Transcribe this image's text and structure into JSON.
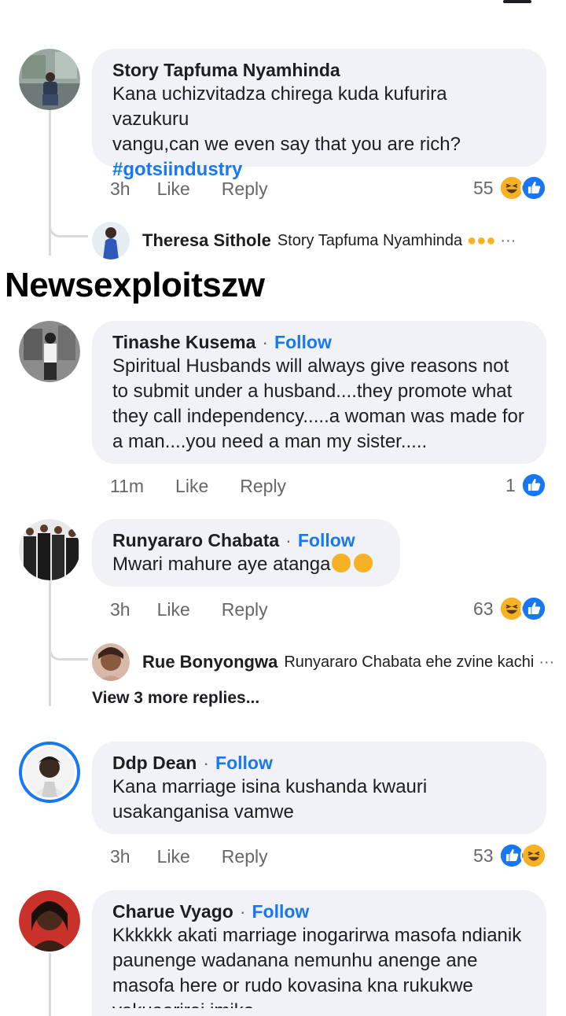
{
  "comments": [
    {
      "author": "Story Tapfuma Nyamhinda",
      "lines": [
        "Kana uchizvitadza chirega kuda kufurira vazukuru",
        "vangu,can we even say that you are rich?"
      ],
      "hashtag": "#gotsiindustry",
      "time": "3h",
      "like": "Like",
      "reply": "Reply",
      "count": "55",
      "reaction_icons": [
        "haha-icon",
        "like-icon"
      ],
      "replies": [
        {
          "author": "Theresa Sithole",
          "text": "Story Tapfuma Nyamhinda",
          "more": "···"
        }
      ]
    },
    {
      "author": "Tinashe Kusema",
      "follow": "Follow",
      "dot": "·",
      "lines": [
        "Spiritual Husbands will always give reasons not",
        "to submit under a husband....they promote what",
        "they call independency.....a woman was made for",
        "a man....you need a man my sister....."
      ],
      "time": "11m",
      "like": "Like",
      "reply": "Reply",
      "count": "1",
      "reaction_icons": [
        "like-icon"
      ]
    },
    {
      "author": "Runyararo Chabata",
      "follow": "Follow",
      "dot": "·",
      "lines": [
        "Mwari mahure aye atanga"
      ],
      "time": "3h",
      "like": "Like",
      "reply": "Reply",
      "count": "63",
      "reaction_icons": [
        "haha-icon",
        "like-icon"
      ],
      "replies": [
        {
          "author": "Rue Bonyongwa",
          "text": "Runyararo Chabata ehe zvine kachi",
          "more": "···"
        }
      ],
      "view_more": "View 3 more replies..."
    },
    {
      "author": "Ddp Dean",
      "follow": "Follow",
      "dot": "·",
      "lines": [
        "Kana marriage isina kushanda kwauri",
        "usakanganisa vamwe"
      ],
      "time": "3h",
      "like": "Like",
      "reply": "Reply",
      "count": "53",
      "reaction_icons": [
        "like-icon",
        "haha-icon"
      ]
    },
    {
      "author": "Charue Vyago",
      "follow": "Follow",
      "dot": "·",
      "lines": [
        "Kkkkkk akati marriage inogarirwa masofa ndianik",
        "paunenge wadanana nemunhu anenge ane",
        "masofa here or rudo kovasina kna rukukwe",
        "vakuaarirei imiko"
      ]
    }
  ],
  "watermark": "Newsexploitszw",
  "colors": {
    "accent": "#1877f2",
    "bubble": "#f0f2f5",
    "muted": "#65676b",
    "haha": "#f7b125"
  }
}
